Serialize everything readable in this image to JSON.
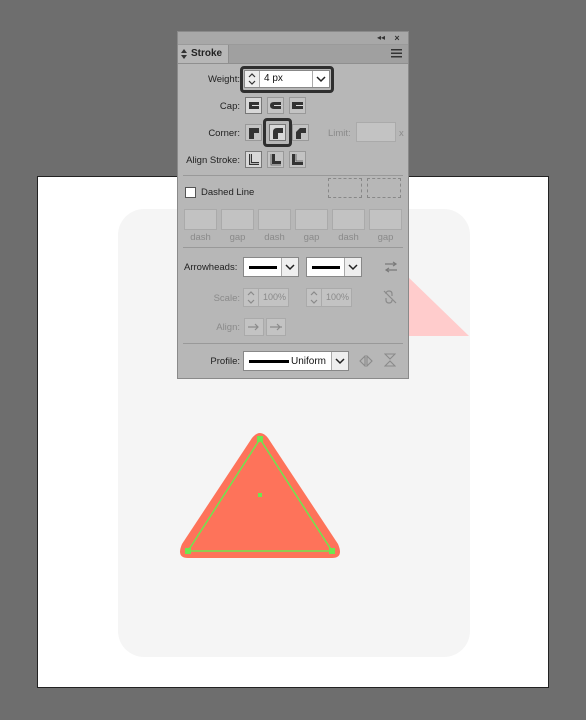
{
  "panel": {
    "tab_label": "Stroke",
    "icons": {
      "collapse": "double-left-arrow-icon",
      "close": "close-icon",
      "menu": "hamburger-menu-icon"
    }
  },
  "weight": {
    "label": "Weight:",
    "value": "4 px"
  },
  "cap": {
    "label": "Cap:",
    "options": [
      "butt-cap",
      "round-cap",
      "projecting-cap"
    ],
    "selected": 0
  },
  "corner": {
    "label": "Corner:",
    "options": [
      "miter-join",
      "round-join",
      "bevel-join"
    ],
    "selected": 1,
    "limit_label": "Limit:",
    "limit_suffix": "x"
  },
  "align_stroke": {
    "label": "Align Stroke:",
    "options": [
      "align-center",
      "align-inside",
      "align-outside"
    ],
    "selected": 0
  },
  "dashed": {
    "label": "Dashed Line",
    "checked": false,
    "field_labels": [
      "dash",
      "gap",
      "dash",
      "gap",
      "dash",
      "gap"
    ]
  },
  "arrowheads": {
    "label": "Arrowheads:"
  },
  "scale": {
    "label": "Scale:",
    "start": "100%",
    "end": "100%"
  },
  "align": {
    "label": "Align:"
  },
  "profile": {
    "label": "Profile:",
    "value": "Uniform"
  },
  "colors": {
    "panel_bg": "#b7b7b7",
    "triangle_fill": "#fe735a",
    "selection": "#6ee64f",
    "fold": "#ffcccc",
    "background": "#6e6e6e"
  }
}
